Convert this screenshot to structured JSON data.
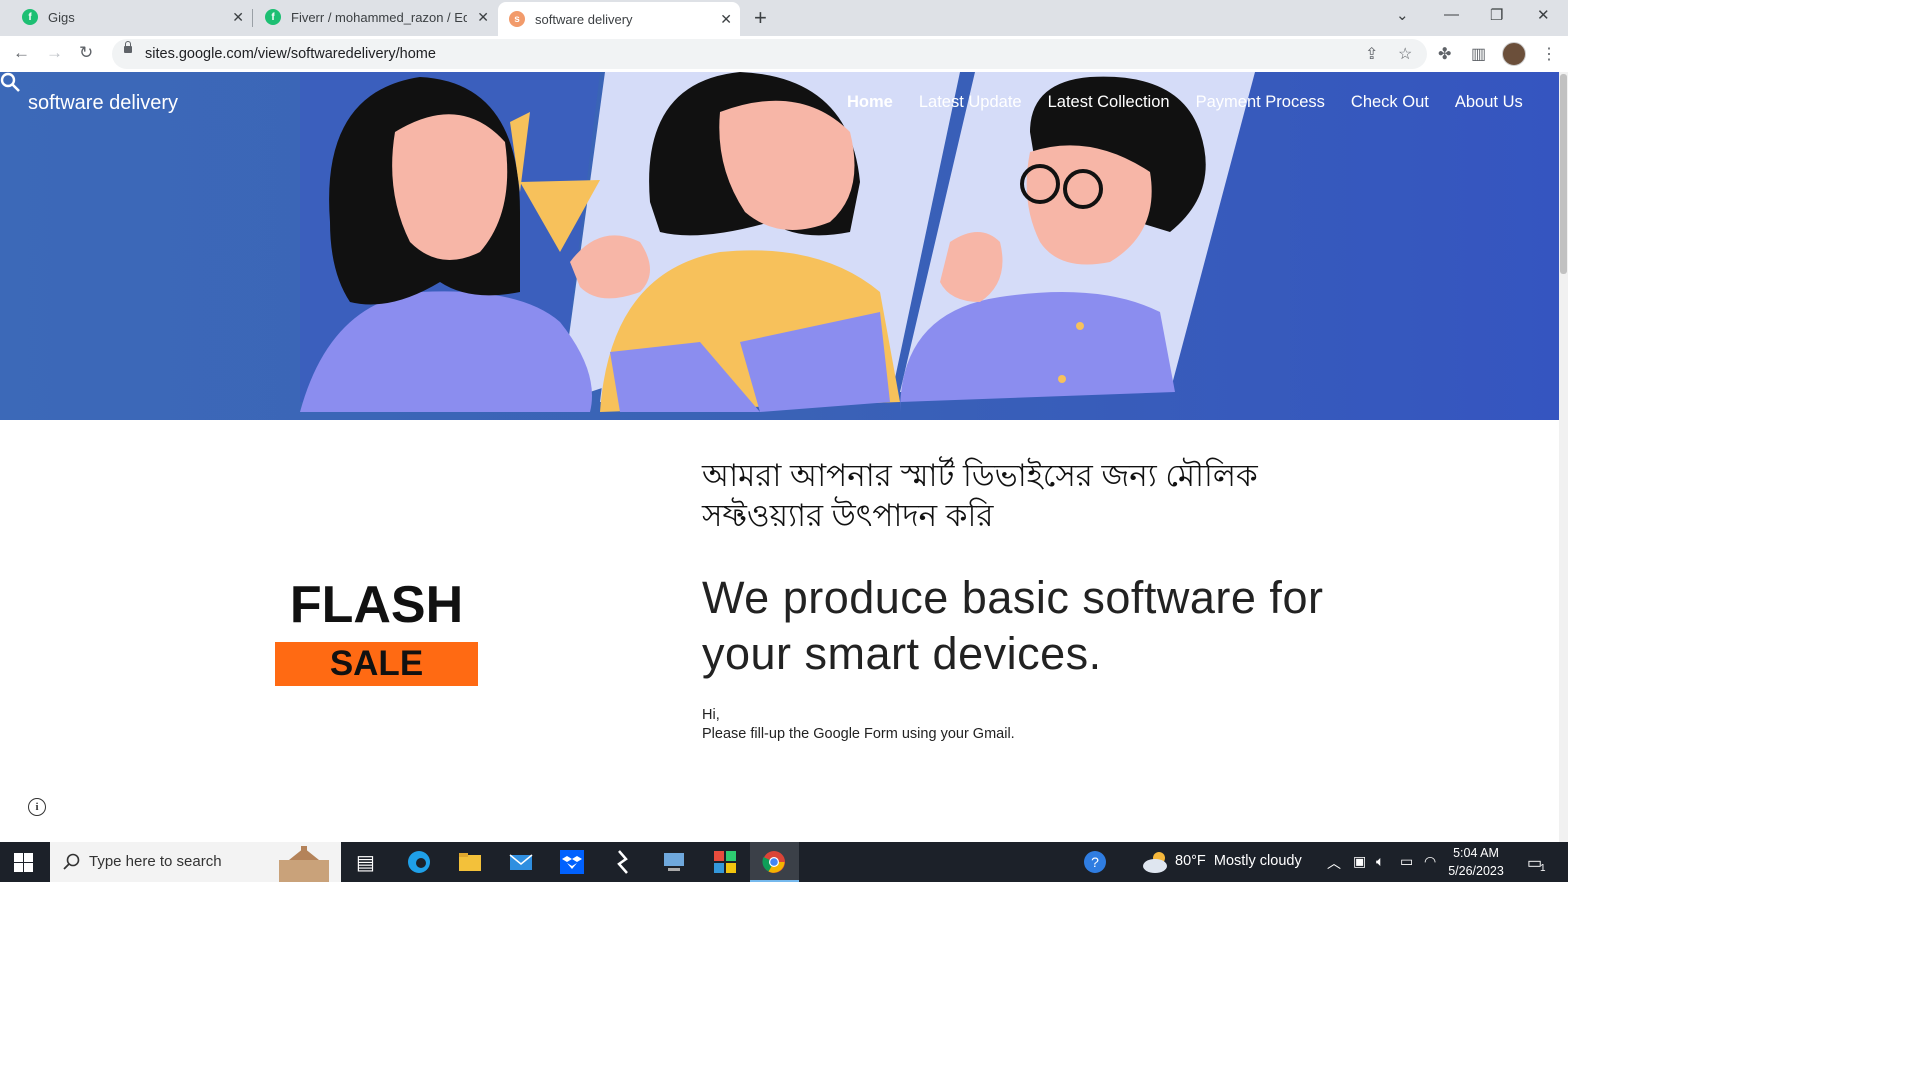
{
  "browser": {
    "tabs": [
      {
        "title": "Gigs",
        "favicon": "fiverr-icon",
        "active": false
      },
      {
        "title": "Fiverr / mohammed_razon / Edit",
        "favicon": "fiverr-icon",
        "active": false
      },
      {
        "title": "software delivery",
        "favicon": "google-sites-icon",
        "active": true
      }
    ],
    "url": "sites.google.com/view/softwaredelivery/home"
  },
  "site": {
    "title": "software delivery",
    "nav": [
      "Home",
      "Latest Update",
      "Latest Collection",
      "Payment Process",
      "Check Out",
      "About Us"
    ],
    "active_nav": "Home"
  },
  "content": {
    "flash_word": "FLASH",
    "sale_word": "SALE",
    "bengali_heading": "আমরা আপনার স্মার্ট ডিভাইসের জন্য মৌলিক সফ্টওয়্যার উৎপাদন করি",
    "english_heading": "We produce basic software for your smart devices.",
    "greeting": "Hi,",
    "instruction": "Please fill-up the Google Form using your Gmail."
  },
  "taskbar": {
    "search_placeholder": "Type here to search",
    "weather_temp": "80°F",
    "weather_text": "Mostly cloudy",
    "time": "5:04 AM",
    "date": "5/26/2023",
    "notification_count": "1"
  },
  "colors": {
    "hero_blue": "#3c69b8",
    "sale_orange": "#ff6a13",
    "taskbar": "#1c2129"
  }
}
